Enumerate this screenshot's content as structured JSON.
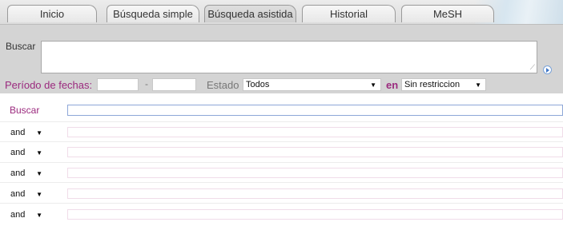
{
  "tabs": [
    {
      "label": "Inicio",
      "active": false
    },
    {
      "label": "Búsqueda simple",
      "active": false
    },
    {
      "label": "Búsqueda asistida",
      "active": true
    },
    {
      "label": "Historial",
      "active": false
    },
    {
      "label": "MeSH",
      "active": false
    }
  ],
  "simple_search": {
    "label": "Buscar",
    "value": "",
    "date_range": {
      "label": "Período de fechas:",
      "from": "",
      "separator": "-",
      "to": ""
    },
    "status": {
      "label": "Estado",
      "selected": "Todos"
    },
    "scope": {
      "label": "en",
      "selected": "Sin restriccion"
    }
  },
  "advanced_search": {
    "label": "Buscar",
    "first_value": "",
    "rows": [
      {
        "operator": "and",
        "value": ""
      },
      {
        "operator": "and",
        "value": ""
      },
      {
        "operator": "and",
        "value": ""
      },
      {
        "operator": "and",
        "value": ""
      },
      {
        "operator": "and",
        "value": ""
      }
    ]
  },
  "colors": {
    "label_accent": "#9b2a7e",
    "panel_bg": "#d4d4d4",
    "focus_border": "#8ea7d8"
  },
  "icons": {
    "go": "play-circle-icon",
    "resize": "resize-grip-icon",
    "dropdown": "caret-down-icon"
  }
}
